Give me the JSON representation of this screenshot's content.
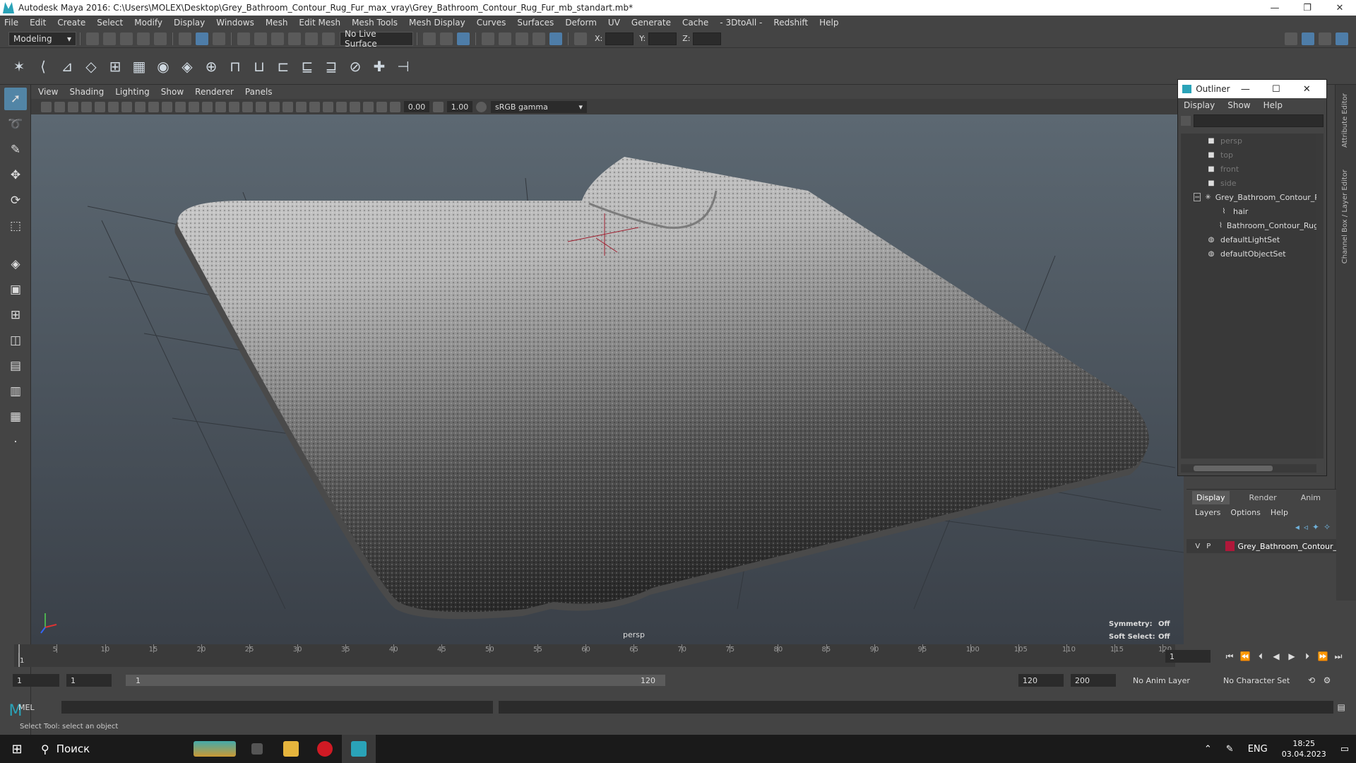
{
  "window": {
    "title": "Autodesk Maya 2016: C:\\Users\\MOLEX\\Desktop\\Grey_Bathroom_Contour_Rug_Fur_max_vray\\Grey_Bathroom_Contour_Rug_Fur_mb_standart.mb*",
    "min": "—",
    "max": "❐",
    "close": "✕"
  },
  "menubar": [
    "File",
    "Edit",
    "Create",
    "Select",
    "Modify",
    "Display",
    "Windows",
    "Mesh",
    "Edit Mesh",
    "Mesh Tools",
    "Mesh Display",
    "Curves",
    "Surfaces",
    "Deform",
    "UV",
    "Generate",
    "Cache",
    "- 3DtoAll -",
    "Redshift",
    "Help"
  ],
  "statusline": {
    "mode": "Modeling",
    "live_surface": "No Live Surface",
    "x_label": "X:",
    "y_label": "Y:",
    "z_label": "Z:"
  },
  "shelf_icons": [
    "✶",
    "⟨",
    "⊿",
    "◇",
    "⊞",
    "▦",
    "◉",
    "◈",
    "⊕",
    "⊓",
    "⊔",
    "⊏",
    "⊑",
    "⊒",
    "⊘",
    "✚",
    "⊣"
  ],
  "panel": {
    "menus": [
      "View",
      "Shading",
      "Lighting",
      "Show",
      "Renderer",
      "Panels"
    ],
    "exposure": "0.00",
    "gamma_value": "1.00",
    "color_space": "sRGB gamma",
    "camera": "persp"
  },
  "hud": {
    "symmetry_label": "Symmetry:",
    "symmetry_value": "Off",
    "soft_select_label": "Soft Select:",
    "soft_select_value": "Off"
  },
  "outliner": {
    "title": "Outliner",
    "menus": [
      "Display",
      "Show",
      "Help"
    ],
    "items": [
      {
        "label": "persp",
        "indent": 1,
        "icon": "■",
        "dim": true
      },
      {
        "label": "top",
        "indent": 1,
        "icon": "■",
        "dim": true
      },
      {
        "label": "front",
        "indent": 1,
        "icon": "■",
        "dim": true
      },
      {
        "label": "side",
        "indent": 1,
        "icon": "■",
        "dim": true
      },
      {
        "label": "Grey_Bathroom_Contour_Rug",
        "indent": 1,
        "icon": "✳",
        "dim": false,
        "expander": "−"
      },
      {
        "label": "hair",
        "indent": 2,
        "icon": "⌇",
        "dim": false
      },
      {
        "label": "Bathroom_Contour_Rug",
        "indent": 2,
        "icon": "⌇",
        "dim": false
      },
      {
        "label": "defaultLightSet",
        "indent": 1,
        "icon": "◍",
        "dim": false
      },
      {
        "label": "defaultObjectSet",
        "indent": 1,
        "icon": "◍",
        "dim": false
      }
    ]
  },
  "side_tabs": [
    "Attribute Editor",
    "Channel Box / Layer Editor"
  ],
  "layers": {
    "tabs": [
      "Display",
      "Render",
      "Anim"
    ],
    "menus": [
      "Layers",
      "Options",
      "Help"
    ],
    "row": {
      "v": "V",
      "p": "P",
      "name": "Grey_Bathroom_Contour_Rug",
      "color": "#b0183a"
    }
  },
  "timeline": {
    "ticks": [
      1,
      5,
      10,
      15,
      20,
      25,
      30,
      35,
      40,
      45,
      50,
      55,
      60,
      65,
      70,
      75,
      80,
      85,
      90,
      95,
      100,
      105,
      110,
      115,
      120
    ],
    "current_frame": "1"
  },
  "range": {
    "start": "1",
    "start2": "1",
    "slider_start": "1",
    "slider_end": "120",
    "end": "120",
    "end2": "200",
    "anim_layer": "No Anim Layer",
    "char_set": "No Character Set"
  },
  "command": {
    "label": "MEL",
    "help": "Select Tool: select an object"
  },
  "taskbar": {
    "search": "Поиск",
    "lang": "ENG",
    "time": "18:25",
    "date": "03.04.2023"
  }
}
